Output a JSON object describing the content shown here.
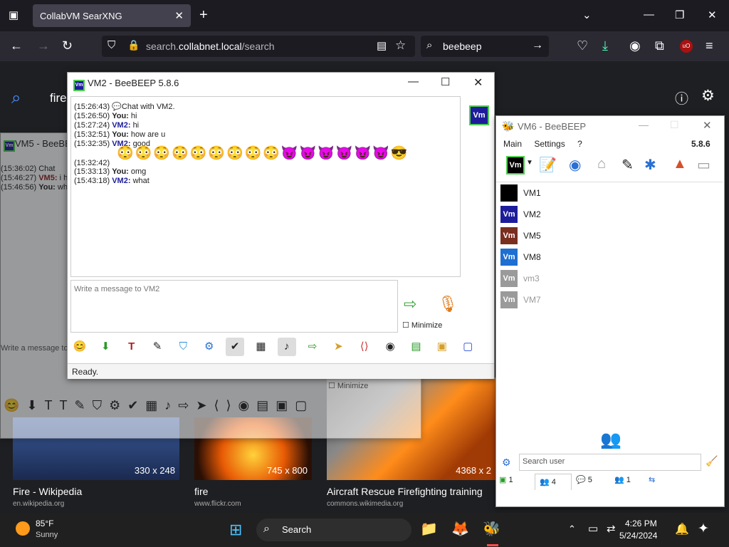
{
  "browser": {
    "tab_title": "CollabVM SearXNG",
    "url_host": "search.",
    "url_domain": "collabnet.local",
    "url_path": "/search",
    "search_value": "beebeep",
    "page_search_partial": "fire"
  },
  "thumbs": [
    {
      "size": "330 x 248",
      "title": "Fire - Wikipedia",
      "source": "en.wikipedia.org"
    },
    {
      "size": "745 x 800",
      "title": "fire",
      "source": "www.flickr.com"
    },
    {
      "size": "4368 x 2",
      "title": "Aircraft Rescue Firefighting training",
      "source": "commons.wikimedia.org"
    }
  ],
  "vm5_window": {
    "title": "VM5 - BeeBEEP",
    "lines": [
      {
        "ts": "(15:36:02)",
        "who": "",
        "text": "Chat"
      },
      {
        "ts": "(15:46:27)",
        "who": "VM5:",
        "text": "i h"
      },
      {
        "ts": "(15:46:56)",
        "who": "You:",
        "text": "wh"
      }
    ],
    "input_placeholder": "Write a message to",
    "minimize_label": "Minimize",
    "bg_text": "fire"
  },
  "vm2_window": {
    "title": "VM2 - BeeBEEP 5.8.6",
    "lines": [
      {
        "ts": "(15:26:43)",
        "who": "",
        "text": "Chat with VM2."
      },
      {
        "ts": "(15:26:50)",
        "who": "You:",
        "text": "hi"
      },
      {
        "ts": "(15:27:24)",
        "who": "VM2:",
        "text": "hi"
      },
      {
        "ts": "(15:32:51)",
        "who": "You:",
        "text": "how are u"
      },
      {
        "ts": "(15:32:35)",
        "who": "VM2:",
        "text": "good"
      },
      {
        "ts": "(15:32:42)",
        "who": "",
        "text": ""
      },
      {
        "ts": "(15:33:13)",
        "who": "You:",
        "text": "omg"
      },
      {
        "ts": "(15:43:18)",
        "who": "VM2:",
        "text": "what"
      }
    ],
    "emoji_line": "😳😳😳😳😳😳😳😳😳😈😈😈😈😈😈😎",
    "input_placeholder": "Write a message to VM2",
    "minimize_label": "Minimize",
    "status": "Ready.",
    "avatar_label": "Vm"
  },
  "vm6_window": {
    "title": "VM6 - BeeBEEP",
    "menu": [
      "Main",
      "Settings",
      "?"
    ],
    "version": "5.8.6",
    "users": [
      {
        "name": "VM1",
        "color": "#000000",
        "label": "",
        "online": true
      },
      {
        "name": "VM2",
        "color": "#1d1d9c",
        "label": "Vm",
        "online": true
      },
      {
        "name": "VM5",
        "color": "#7a2e1e",
        "label": "Vm",
        "online": true
      },
      {
        "name": "VM8",
        "color": "#1e6fd1",
        "label": "Vm",
        "online": true
      },
      {
        "name": "vm3",
        "color": "#9a9a9a",
        "label": "Vm",
        "online": false
      },
      {
        "name": "VM7",
        "color": "#9a9a9a",
        "label": "Vm",
        "online": false
      }
    ],
    "search_placeholder": "Search user",
    "tabs": [
      "1",
      "4",
      "5",
      "1",
      ""
    ]
  },
  "taskbar": {
    "weather_temp": "85°F",
    "weather_desc": "Sunny",
    "search_label": "Search",
    "time": "4:26 PM",
    "date": "5/24/2024"
  }
}
